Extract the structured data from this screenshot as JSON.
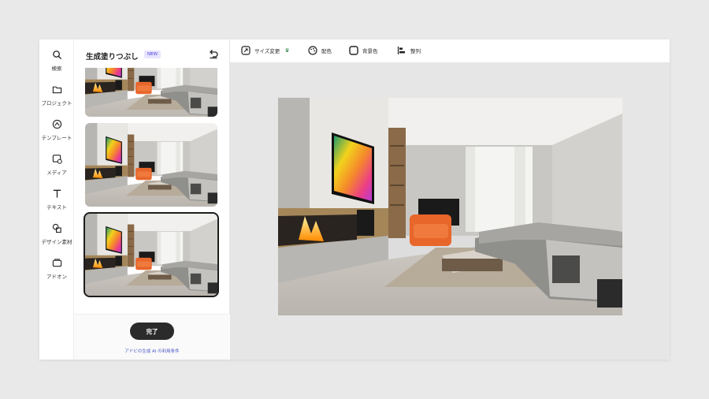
{
  "sidebar": {
    "items": [
      {
        "label": "検索",
        "icon": "search-icon"
      },
      {
        "label": "プロジェクト",
        "icon": "folder-icon"
      },
      {
        "label": "テンプレート",
        "icon": "template-icon"
      },
      {
        "label": "メディア",
        "icon": "media-icon"
      },
      {
        "label": "テキスト",
        "icon": "text-icon"
      },
      {
        "label": "デザイン素材",
        "icon": "design-assets-icon"
      },
      {
        "label": "アドオン",
        "icon": "add-ons-icon"
      }
    ]
  },
  "panel": {
    "title": "生成塗りつぶし",
    "badge": "NEW",
    "done_label": "完了",
    "terms_link": "アドビの生成 AI の利用条件",
    "selected_variation": 3
  },
  "toolbar": {
    "items": [
      {
        "label": "サイズ変更",
        "icon": "resize-icon",
        "premium": true,
        "premium_icon": "crown-icon"
      },
      {
        "label": "配色",
        "icon": "palette-icon"
      },
      {
        "label": "背景色",
        "icon": "background-color-icon"
      },
      {
        "label": "整列",
        "icon": "align-icon"
      }
    ]
  },
  "colors": {
    "accent": "#2b2b2b",
    "badge_bg": "#e7e4ff",
    "badge_text": "#4a3fd9",
    "link": "#4a57c5",
    "chair": "#e8662a"
  }
}
